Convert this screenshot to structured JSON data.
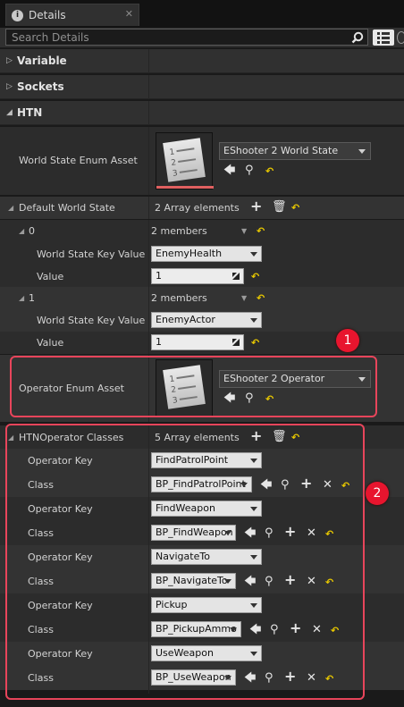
{
  "tab": {
    "title": "Details"
  },
  "search": {
    "placeholder": "Search Details"
  },
  "categories": {
    "variable": "Variable",
    "sockets": "Sockets",
    "htn": "HTN"
  },
  "world_state_enum": {
    "label": "World State Enum Asset",
    "value": "EShooter 2 World State"
  },
  "default_world_state": {
    "label": "Default World State",
    "count": "2 Array elements",
    "elements": [
      {
        "index": "0",
        "members": "2 members",
        "key_label": "World State Key Value",
        "key_value": "EnemyHealth",
        "value_label": "Value",
        "value": "1"
      },
      {
        "index": "1",
        "members": "2 members",
        "key_label": "World State Key Value",
        "key_value": "EnemyActor",
        "value_label": "Value",
        "value": "1"
      }
    ]
  },
  "operator_enum": {
    "label": "Operator Enum Asset",
    "value": "EShooter 2 Operator"
  },
  "htn_operator_classes": {
    "label": "HTNOperator Classes",
    "count": "5 Array elements",
    "items": [
      {
        "key_label": "Operator Key",
        "key": "FindPatrolPoint",
        "class_label": "Class",
        "class": "BP_FindPatrolPoint"
      },
      {
        "key_label": "Operator Key",
        "key": "FindWeapon",
        "class_label": "Class",
        "class": "BP_FindWeapon"
      },
      {
        "key_label": "Operator Key",
        "key": "NavigateTo",
        "class_label": "Class",
        "class": "BP_NavigateTo"
      },
      {
        "key_label": "Operator Key",
        "key": "Pickup",
        "class_label": "Class",
        "class": "BP_PickupAmmo"
      },
      {
        "key_label": "Operator Key",
        "key": "UseWeapon",
        "class_label": "Class",
        "class": "BP_UseWeapon"
      }
    ]
  },
  "badges": {
    "one": "1",
    "two": "2"
  },
  "colors": {
    "panel": "#2c2c2c",
    "callout": "#e8455b",
    "badge": "#e8152e",
    "reset_arrow": "#e8c800"
  }
}
